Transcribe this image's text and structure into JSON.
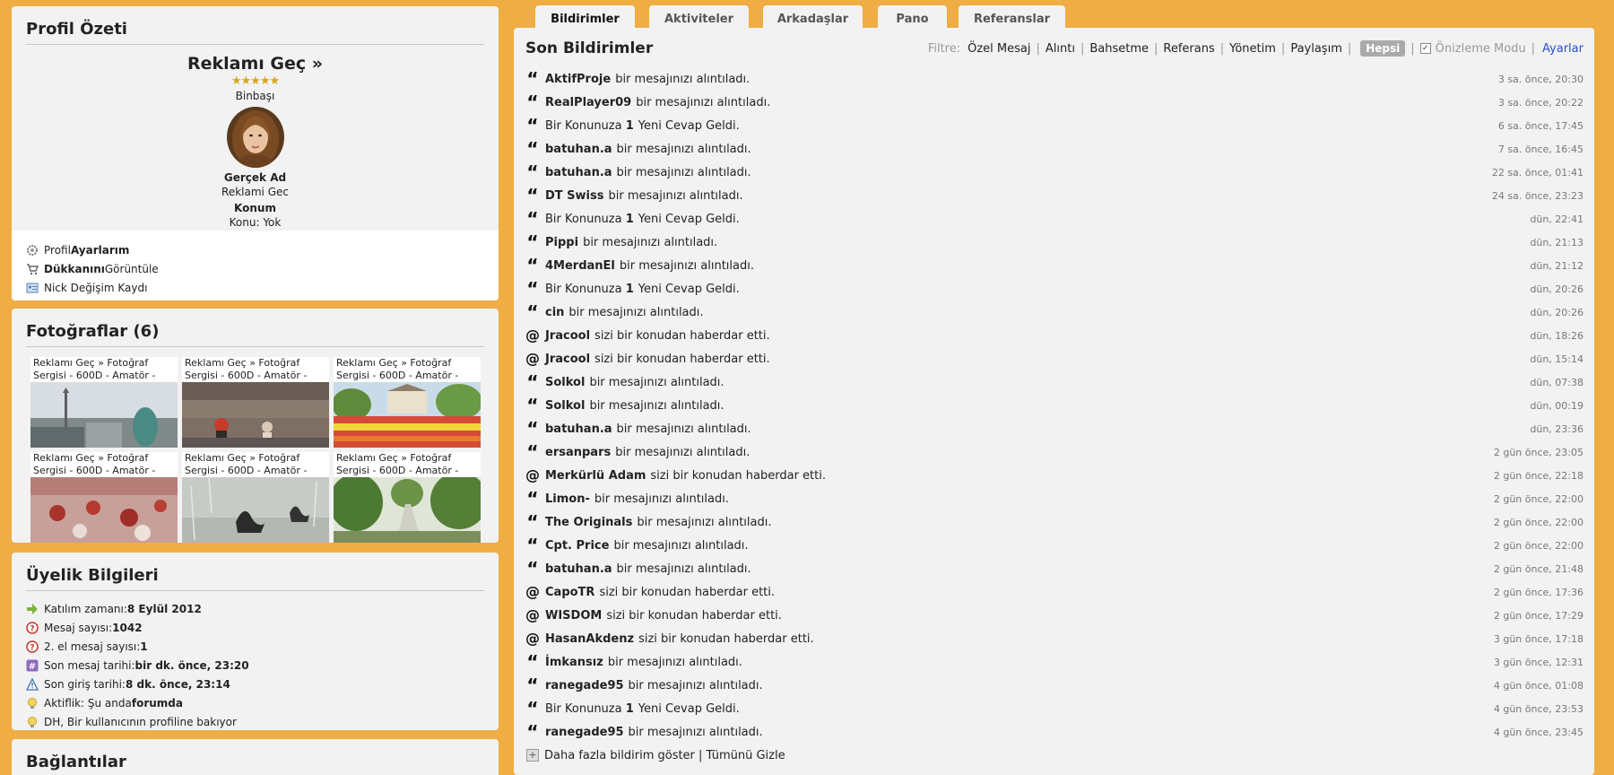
{
  "profile": {
    "title": "Profil Özeti",
    "name": "Reklamı Geç »",
    "stars": "★★★★★",
    "rank": "Binbaşı",
    "real_name_label": "Gerçek Ad",
    "real_name": "Reklami Gec",
    "location_label": "Konum",
    "location": "Konu: Yok",
    "links": [
      {
        "pre": "Profil ",
        "bold": "Ayarlarım",
        "post": ""
      },
      {
        "pre": "",
        "bold": "Dükkanını",
        "post": " Görüntüle"
      },
      {
        "pre": "Nick Değişim Kaydı",
        "bold": "",
        "post": ""
      }
    ]
  },
  "photos": {
    "title": "Fotoğraflar (6)",
    "caption": "Reklamı Geç » Fotoğraf Sergisi - 600D - Amatör -"
  },
  "membership": {
    "title": "Üyelik Bilgileri",
    "rows": [
      {
        "label": "Katılım zamanı: ",
        "value": "8 Eylül 2012"
      },
      {
        "label": "Mesaj sayısı: ",
        "value": "1042"
      },
      {
        "label": "2. el mesaj sayısı: ",
        "value": "1"
      },
      {
        "label": "Son mesaj tarihi: ",
        "value": "bir dk. önce, 23:20"
      },
      {
        "label": "Son giriş tarihi: ",
        "value": "8 dk. önce, 23:14"
      },
      {
        "label": "Aktiflik: Şu anda ",
        "value": "forumda"
      },
      {
        "label": "DH, Bir kullanıcının profiline bakıyor",
        "value": ""
      }
    ]
  },
  "links_section": {
    "title": "Bağlantılar"
  },
  "tabs": [
    "Bildirimler",
    "Aktiviteler",
    "Arkadaşlar",
    "Pano",
    "Referanslar"
  ],
  "notifications": {
    "title": "Son Bildirimler",
    "filter_label": "Filtre:",
    "filters": [
      "Özel Mesaj",
      "Alıntı",
      "Bahsetme",
      "Referans",
      "Yönetim",
      "Paylaşım"
    ],
    "active_filter": "Hepsi",
    "preview_mode": "Önizleme Modu",
    "settings": "Ayarlar",
    "items": [
      {
        "type": "quote",
        "user": "AktifProje",
        "text": "bir mesajınızı alıntıladı.",
        "time": "3 sa. önce, 20:30"
      },
      {
        "type": "quote",
        "user": "RealPlayer09",
        "text": "bir mesajınızı alıntıladı.",
        "time": "3 sa. önce, 20:22"
      },
      {
        "type": "quote",
        "pre": "Bir Konunuza ",
        "user": "1",
        "text": "Yeni Cevap Geldi.",
        "time": "6 sa. önce, 17:45"
      },
      {
        "type": "quote",
        "user": "batuhan.a",
        "text": "bir mesajınızı alıntıladı.",
        "time": "7 sa. önce, 16:45"
      },
      {
        "type": "quote",
        "user": "batuhan.a",
        "text": "bir mesajınızı alıntıladı.",
        "time": "22 sa. önce, 01:41"
      },
      {
        "type": "quote",
        "user": "DT Swiss",
        "text": "bir mesajınızı alıntıladı.",
        "time": "24 sa. önce, 23:23"
      },
      {
        "type": "quote",
        "pre": "Bir Konunuza ",
        "user": "1",
        "text": "Yeni Cevap Geldi.",
        "time": "dün, 22:41"
      },
      {
        "type": "quote",
        "user": "Pippi",
        "text": "bir mesajınızı alıntıladı.",
        "time": "dün, 21:13"
      },
      {
        "type": "quote",
        "user": "4MerdanEl",
        "text": "bir mesajınızı alıntıladı.",
        "time": "dün, 21:12"
      },
      {
        "type": "quote",
        "pre": "Bir Konunuza ",
        "user": "1",
        "text": "Yeni Cevap Geldi.",
        "time": "dün, 20:26"
      },
      {
        "type": "quote",
        "user": "cin",
        "text": "bir mesajınızı alıntıladı.",
        "time": "dün, 20:26"
      },
      {
        "type": "mention",
        "user": "Jracool",
        "text": "sizi bir konudan haberdar etti.",
        "time": "dün, 18:26"
      },
      {
        "type": "mention",
        "user": "Jracool",
        "text": "sizi bir konudan haberdar etti.",
        "time": "dün, 15:14"
      },
      {
        "type": "quote",
        "user": "Solkol",
        "text": "bir mesajınızı alıntıladı.",
        "time": "dün, 07:38"
      },
      {
        "type": "quote",
        "user": "Solkol",
        "text": "bir mesajınızı alıntıladı.",
        "time": "dün, 00:19"
      },
      {
        "type": "quote",
        "user": "batuhan.a",
        "text": "bir mesajınızı alıntıladı.",
        "time": "dün, 23:36"
      },
      {
        "type": "quote",
        "user": "ersanpars",
        "text": "bir mesajınızı alıntıladı.",
        "time": "2 gün önce, 23:05"
      },
      {
        "type": "mention",
        "user": "Merkürlü Adam",
        "text": "sizi bir konudan haberdar etti.",
        "time": "2 gün önce, 22:18"
      },
      {
        "type": "quote",
        "user": "Limon-",
        "text": "bir mesajınızı alıntıladı.",
        "time": "2 gün önce, 22:00"
      },
      {
        "type": "quote",
        "user": "The Originals",
        "text": "bir mesajınızı alıntıladı.",
        "time": "2 gün önce, 22:00"
      },
      {
        "type": "quote",
        "user": "Cpt. Price",
        "text": "bir mesajınızı alıntıladı.",
        "time": "2 gün önce, 22:00"
      },
      {
        "type": "quote",
        "user": "batuhan.a",
        "text": "bir mesajınızı alıntıladı.",
        "time": "2 gün önce, 21:48"
      },
      {
        "type": "mention",
        "user": "CapoTR",
        "text": "sizi bir konudan haberdar etti.",
        "time": "2 gün önce, 17:36"
      },
      {
        "type": "mention",
        "user": "WISDOM",
        "text": "sizi bir konudan haberdar etti.",
        "time": "2 gün önce, 17:29"
      },
      {
        "type": "mention",
        "user": "HasanAkdenz",
        "text": "sizi bir konudan haberdar etti.",
        "time": "3 gün önce, 17:18"
      },
      {
        "type": "quote",
        "user": "İmkansız",
        "text": "bir mesajınızı alıntıladı.",
        "time": "3 gün önce, 12:31"
      },
      {
        "type": "quote",
        "user": "ranegade95",
        "text": "bir mesajınızı alıntıladı.",
        "time": "4 gün önce, 01:08"
      },
      {
        "type": "quote",
        "pre": "Bir Konunuza ",
        "user": "1",
        "text": "Yeni Cevap Geldi.",
        "time": "4 gün önce, 23:53"
      },
      {
        "type": "quote",
        "user": "ranegade95",
        "text": "bir mesajınızı alıntıladı.",
        "time": "4 gün önce, 23:45"
      }
    ],
    "more": "Daha fazla bildirim göster | Tümünü Gizle"
  }
}
